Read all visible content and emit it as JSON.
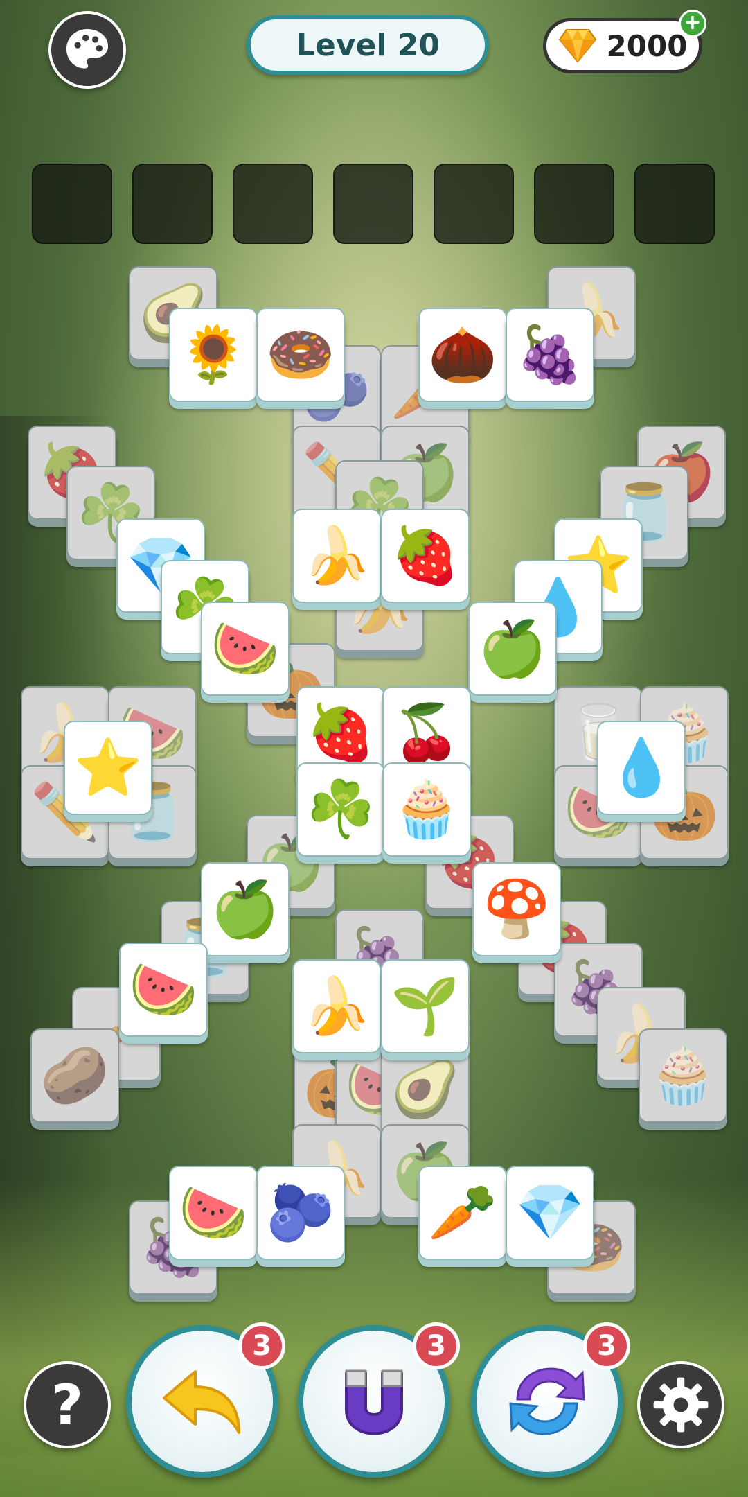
{
  "header": {
    "level_label": "Level 20",
    "gems": "2000",
    "palette_icon": "palette-icon",
    "gem_icon": "gem-icon",
    "plus_label": "+"
  },
  "tray": {
    "slot_count": 7
  },
  "tiles": [
    {
      "symbol": "🥑",
      "name": "avocado",
      "blocked": true
    },
    {
      "symbol": "🍌",
      "name": "banana",
      "blocked": true
    },
    {
      "symbol": "🌻",
      "name": "flower",
      "blocked": false
    },
    {
      "symbol": "🍩",
      "name": "donut",
      "blocked": false
    },
    {
      "symbol": "🌰",
      "name": "nut",
      "blocked": false
    },
    {
      "symbol": "🍇",
      "name": "grapes",
      "blocked": false
    },
    {
      "symbol": "🫐",
      "name": "berries",
      "blocked": true
    },
    {
      "symbol": "🥕",
      "name": "carrot",
      "blocked": true
    },
    {
      "symbol": "🍓",
      "name": "strawberry",
      "blocked": true
    },
    {
      "symbol": "🍎",
      "name": "apple-slice",
      "blocked": true
    },
    {
      "symbol": "✏️",
      "name": "pencil",
      "blocked": true
    },
    {
      "symbol": "🍏",
      "name": "green-apple",
      "blocked": true
    },
    {
      "symbol": "☘️",
      "name": "clover",
      "blocked": true
    },
    {
      "symbol": "🫙",
      "name": "jar",
      "blocked": true
    },
    {
      "symbol": "☘️",
      "name": "clover",
      "blocked": true
    },
    {
      "symbol": "💎",
      "name": "diamond",
      "blocked": false
    },
    {
      "symbol": "⭐",
      "name": "star",
      "blocked": false
    },
    {
      "symbol": "🍌",
      "name": "banana",
      "blocked": false
    },
    {
      "symbol": "🍓",
      "name": "strawberry",
      "blocked": false
    },
    {
      "symbol": "☘️",
      "name": "clover",
      "blocked": false
    },
    {
      "symbol": "💧",
      "name": "water-drop",
      "blocked": false
    },
    {
      "symbol": "🍉",
      "name": "watermelon",
      "blocked": false
    },
    {
      "symbol": "🍌",
      "name": "banana",
      "blocked": true
    },
    {
      "symbol": "🍏",
      "name": "green-apple",
      "blocked": false
    },
    {
      "symbol": "🎃",
      "name": "pumpkin",
      "blocked": true
    },
    {
      "symbol": "🍌",
      "name": "banana",
      "blocked": true
    },
    {
      "symbol": "🍉",
      "name": "watermelon",
      "blocked": true
    },
    {
      "symbol": "🍓",
      "name": "strawberry",
      "blocked": false
    },
    {
      "symbol": "🍒",
      "name": "cherries",
      "blocked": false
    },
    {
      "symbol": "🥛",
      "name": "milk",
      "blocked": true
    },
    {
      "symbol": "🧁",
      "name": "cupcake",
      "blocked": true
    },
    {
      "symbol": "⭐",
      "name": "star",
      "blocked": false
    },
    {
      "symbol": "✏️",
      "name": "pencil",
      "blocked": true
    },
    {
      "symbol": "🫙",
      "name": "jar",
      "blocked": true
    },
    {
      "symbol": "☘️",
      "name": "clover",
      "blocked": false
    },
    {
      "symbol": "🧁",
      "name": "cupcake",
      "blocked": false
    },
    {
      "symbol": "💧",
      "name": "water-drop",
      "blocked": false
    },
    {
      "symbol": "🍉",
      "name": "watermelon",
      "blocked": true
    },
    {
      "symbol": "🎃",
      "name": "pumpkin",
      "blocked": true
    },
    {
      "symbol": "🍏",
      "name": "green-apple",
      "blocked": true
    },
    {
      "symbol": "🍓",
      "name": "strawberry",
      "blocked": true
    },
    {
      "symbol": "🍏",
      "name": "green-apple",
      "blocked": false
    },
    {
      "symbol": "🍄",
      "name": "mushroom",
      "blocked": false
    },
    {
      "symbol": "🫙",
      "name": "jar",
      "blocked": true
    },
    {
      "symbol": "🍇",
      "name": "plum",
      "blocked": true
    },
    {
      "symbol": "🍓",
      "name": "strawberry",
      "blocked": true
    },
    {
      "symbol": "🍉",
      "name": "watermelon",
      "blocked": false
    },
    {
      "symbol": "🍇",
      "name": "grapes",
      "blocked": true
    },
    {
      "symbol": "🍌",
      "name": "banana",
      "blocked": false
    },
    {
      "symbol": "🌱",
      "name": "sprout",
      "blocked": false
    },
    {
      "symbol": "🥕",
      "name": "radish",
      "blocked": true
    },
    {
      "symbol": "🍌",
      "name": "banana",
      "blocked": true
    },
    {
      "symbol": "🥔",
      "name": "potato",
      "blocked": true
    },
    {
      "symbol": "🧁",
      "name": "cupcake",
      "blocked": true
    },
    {
      "symbol": "🎃",
      "name": "pumpkin",
      "blocked": true
    },
    {
      "symbol": "🍉",
      "name": "watermelon",
      "blocked": true
    },
    {
      "symbol": "🥑",
      "name": "avocado",
      "blocked": true
    },
    {
      "symbol": "🍌",
      "name": "banana",
      "blocked": true
    },
    {
      "symbol": "🍏",
      "name": "green-apple",
      "blocked": true
    },
    {
      "symbol": "🍇",
      "name": "grapes",
      "blocked": true
    },
    {
      "symbol": "🍉",
      "name": "watermelon",
      "blocked": false
    },
    {
      "symbol": "🫐",
      "name": "berries",
      "blocked": false
    },
    {
      "symbol": "🥕",
      "name": "carrot",
      "blocked": false
    },
    {
      "symbol": "💎",
      "name": "diamond",
      "blocked": false
    },
    {
      "symbol": "🍩",
      "name": "donut",
      "blocked": true
    }
  ],
  "tools": {
    "undo": {
      "count": "3",
      "icon": "undo-arrow-icon"
    },
    "magnet": {
      "count": "3",
      "icon": "magnet-icon"
    },
    "shuffle": {
      "count": "3",
      "icon": "shuffle-icon"
    },
    "help_label": "?",
    "settings_icon": "gear-icon"
  },
  "colors": {
    "accent": "#2f8e93",
    "badge": "#d94a55",
    "plus": "#3ea63a"
  }
}
